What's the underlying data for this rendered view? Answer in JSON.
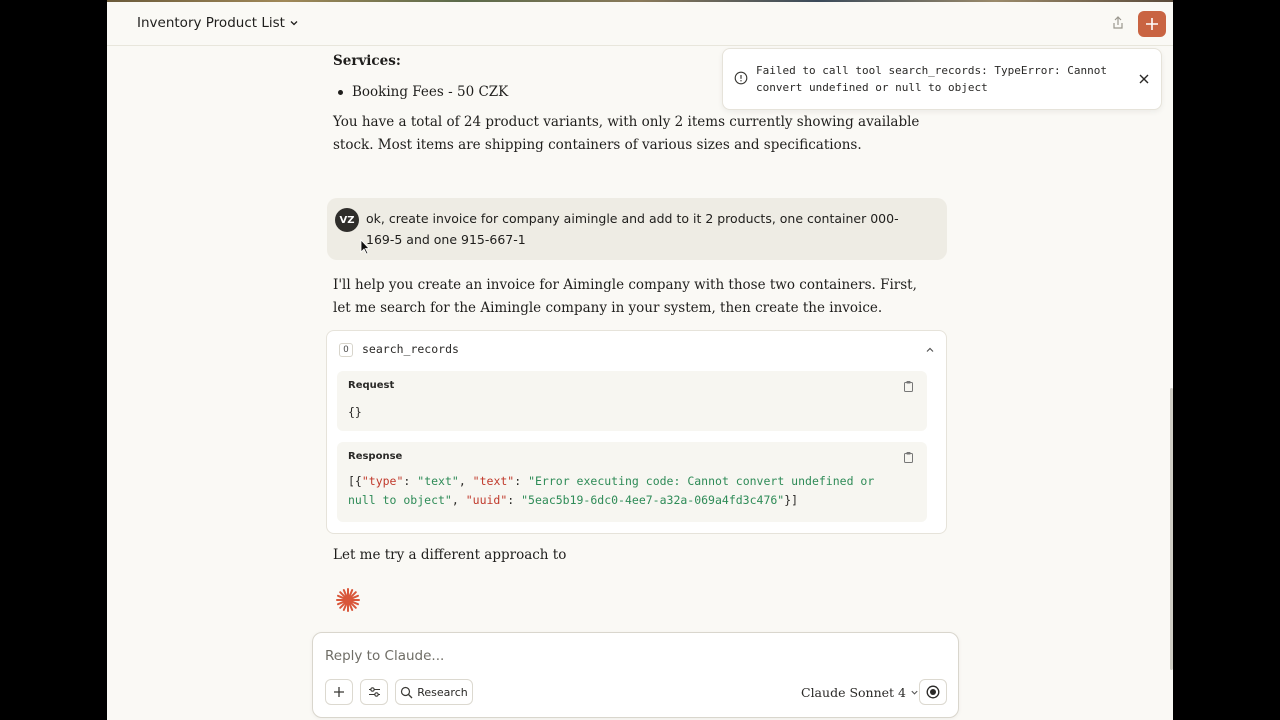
{
  "header": {
    "title": "Inventory Product List",
    "icons": [
      "chevron-down-icon",
      "share-icon",
      "plus-icon"
    ]
  },
  "colors": {
    "accent": "#c96442",
    "background": "#faf9f5",
    "userBubble": "#eeece4",
    "jsonKey": "#c0392b",
    "jsonString": "#2e8b57"
  },
  "toast": {
    "message": "Failed to call tool search_records: TypeError: Cannot convert undefined or null to object",
    "icons": [
      "alert-circle-icon",
      "close-icon"
    ]
  },
  "conversation": {
    "services_heading": "Services:",
    "services_item": "Booking Fees - 50 CZK",
    "summary": "You have a total of 24 product variants, with only 2 items currently showing available stock. Most items are shipping containers of various sizes and specifications.",
    "user": {
      "avatar": "VZ",
      "message": "ok, create invoice for company aimingle and add to it 2 products, one container 000-169-5 and one 915-667-1"
    },
    "assistant_reply": "I'll help you create an invoice for Aimingle company with those two containers. First, let me search for the Aimingle company in your system, then create the invoice.",
    "tool_call": {
      "icon_label": "O",
      "name": "search_records",
      "request_label": "Request",
      "request_body": "{}",
      "response_label": "Response",
      "response": {
        "open": "[{",
        "k1": "\"type\"",
        "sep1": ": ",
        "v1": "\"text\"",
        "c1": ", ",
        "k2": "\"text\"",
        "sep2": ": ",
        "v2": "\"Error executing code: Cannot convert undefined or null to object\"",
        "c2": ", ",
        "k3": "\"uuid\"",
        "sep3": ": ",
        "v3": "\"5eac5b19-6dc0-4ee7-a32a-069a4fd3c476\"",
        "close": "}]"
      }
    },
    "assistant_followup": "Let me try a different approach to"
  },
  "composer": {
    "placeholder": "Reply to Claude...",
    "research_label": "Research",
    "model": "Claude Sonnet 4"
  }
}
